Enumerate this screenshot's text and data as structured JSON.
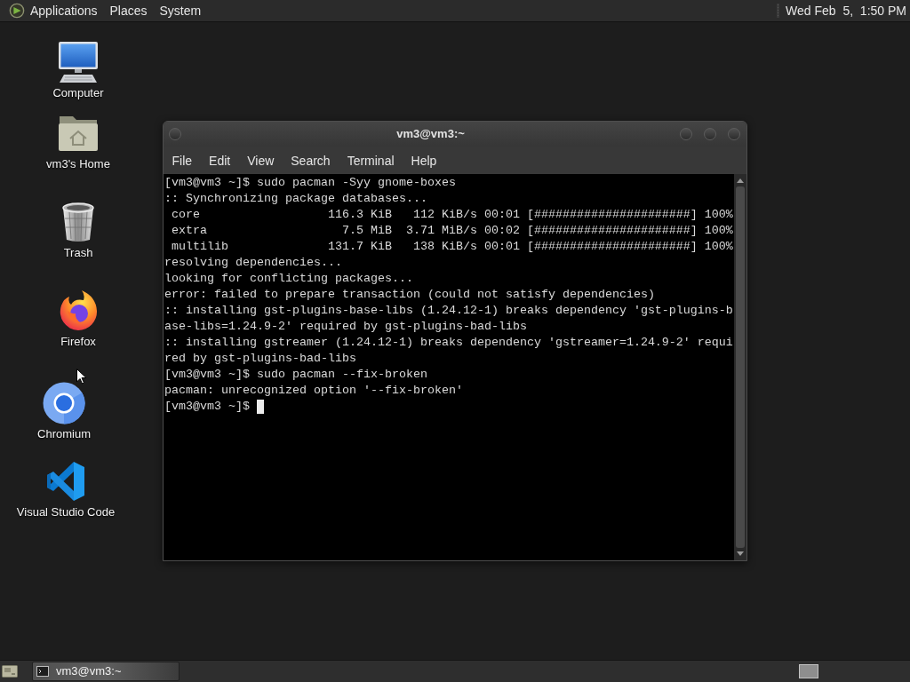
{
  "top_panel": {
    "menus": [
      "Applications",
      "Places",
      "System"
    ],
    "clock": "Wed Feb  5,  1:50 PM"
  },
  "desktop_icons": [
    {
      "kind": "computer",
      "label": "Computer"
    },
    {
      "kind": "home",
      "label": "vm3's Home"
    },
    {
      "kind": "trash",
      "label": "Trash"
    },
    {
      "kind": "firefox",
      "label": "Firefox"
    },
    {
      "kind": "chromium",
      "label": "Chromium"
    },
    {
      "kind": "vscode",
      "label": "Visual Studio Code"
    }
  ],
  "terminal_window": {
    "title": "vm3@vm3:~",
    "menu": [
      "File",
      "Edit",
      "View",
      "Search",
      "Terminal",
      "Help"
    ],
    "lines": [
      "[vm3@vm3 ~]$ sudo pacman -Syy gnome-boxes",
      ":: Synchronizing package databases...",
      " core                  116.3 KiB   112 KiB/s 00:01 [######################] 100%",
      " extra                   7.5 MiB  3.71 MiB/s 00:02 [######################] 100%",
      " multilib              131.7 KiB   138 KiB/s 00:01 [######################] 100%",
      "resolving dependencies...",
      "looking for conflicting packages...",
      "error: failed to prepare transaction (could not satisfy dependencies)",
      ":: installing gst-plugins-base-libs (1.24.12-1) breaks dependency 'gst-plugins-b",
      "ase-libs=1.24.9-2' required by gst-plugins-bad-libs",
      ":: installing gstreamer (1.24.12-1) breaks dependency 'gstreamer=1.24.9-2' requi",
      "red by gst-plugins-bad-libs",
      "[vm3@vm3 ~]$ sudo pacman --fix-broken",
      "pacman: unrecognized option '--fix-broken'"
    ],
    "prompt": "[vm3@vm3 ~]$"
  },
  "taskbar": {
    "windows": [
      {
        "title": "vm3@vm3:~",
        "active": true
      }
    ]
  }
}
